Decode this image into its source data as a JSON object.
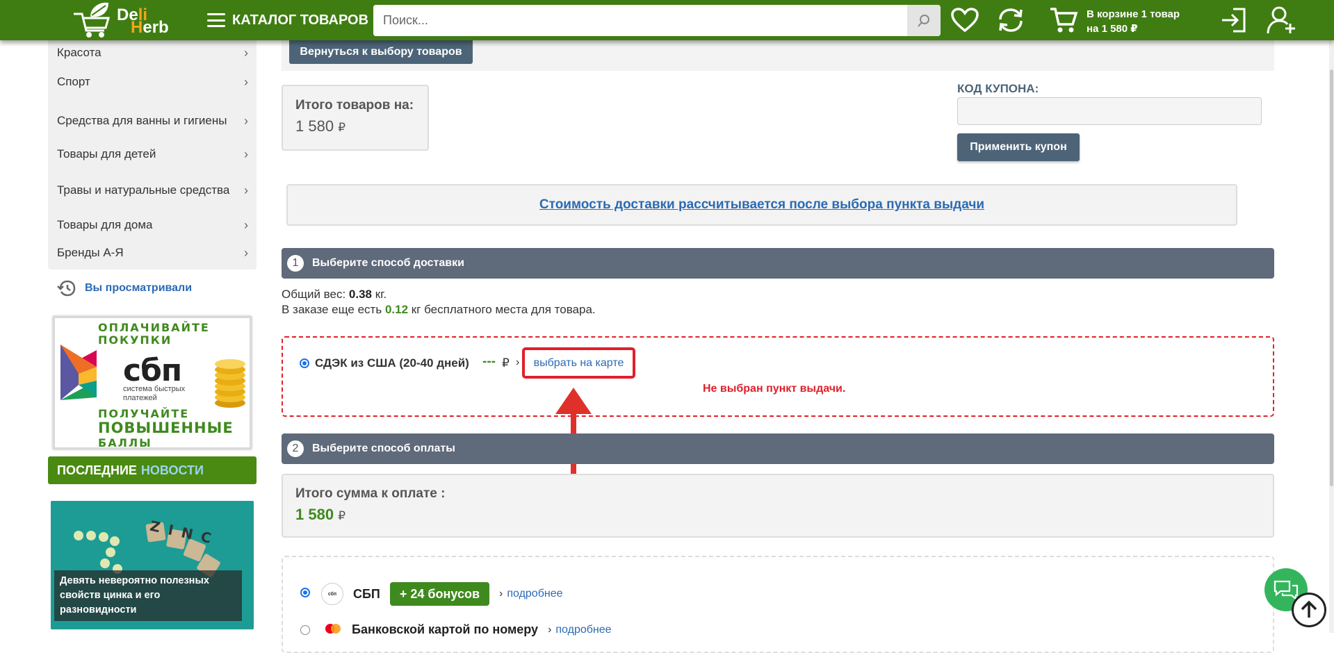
{
  "header": {
    "logo_word_1_a": "De",
    "logo_word_1_b": "li",
    "logo_word_2_a": "H",
    "logo_word_2_b": "erb",
    "catalog_label": "КАТАЛОГ ТОВАРОВ",
    "search_placeholder": "Поиск...",
    "cart_line1": "В корзине 1 товар",
    "cart_line2": "на 1 580 ₽",
    "icons": [
      "search-icon",
      "heart-icon",
      "compare-icon",
      "cart-icon",
      "login-icon",
      "add-user-icon"
    ]
  },
  "sidebar": {
    "items": [
      {
        "label": "Красота"
      },
      {
        "label": "Спорт"
      },
      {
        "label": "Средства для ванны и гигиены"
      },
      {
        "label": "Товары для детей"
      },
      {
        "label": "Травы и натуральные средства"
      },
      {
        "label": "Товары для дома"
      },
      {
        "label": "Бренды А-Я"
      }
    ],
    "chevron": "›",
    "viewed_label": "Вы просматривали",
    "sbp_banner": {
      "line1": "ОПЛАЧИВАЙТЕ",
      "line2": "ПОКУПКИ",
      "logo": "сбп",
      "logo_sub": "система быстрых платежей",
      "line3": "ПОЛУЧАЙТЕ",
      "line4": "ПОВЫШЕННЫЕ",
      "line5": "БАЛЛЫ"
    },
    "news_title_1": "ПОСЛЕДНИЕ",
    "news_title_2": "НОВОСТИ",
    "news_caption": "Девять невероятно полезных свойств цинка и его разновидности",
    "news_image_letters": "ZINC"
  },
  "main": {
    "back_button": "Вернуться к выбору товаров",
    "total_label": "Итого товаров на:",
    "total_value": "1 580",
    "currency": "₽",
    "coupon_label": "КОД КУПОНА:",
    "coupon_value": "",
    "coupon_button": "Применить купон",
    "delivery_note": "Стоимость доставки рассчитывается после выбора пункта выдачи",
    "step1_num": "1",
    "step1_title": "Выберите способ доставки",
    "weight_label": "Общий вес:",
    "weight_value": "0.38",
    "weight_unit": "кг.",
    "free_prefix": "В заказе еще есть",
    "free_value": "0.12",
    "free_suffix": "кг бесплатного места для товара.",
    "ship_label": "СДЭК из США (20-40 дней)",
    "ship_dash": "---",
    "ship_currency": "₽",
    "ship_chev": "›",
    "map_link": "выбрать на карте",
    "ship_error": "Не выбран пункт выдачи.",
    "step2_num": "2",
    "step2_title": "Выберите способ оплаты",
    "pay_total_label": "Итого сумма к оплате :",
    "pay_total_value": "1 580",
    "pay_methods": [
      {
        "name": "СБП",
        "icon_text": "сбп",
        "bonus": "+ 24 бонусов",
        "more": "подробнее",
        "chev": "›",
        "selected": true
      },
      {
        "name": "Банковской картой по номеру",
        "more": "подробнее",
        "chev": "›",
        "selected": false
      }
    ]
  },
  "colors": {
    "header_green": "#3f7d12",
    "slate": "#4d6478",
    "step_bar": "#5f6a7a",
    "error_red": "#e0202a",
    "link_blue": "#2b6ab3",
    "bonus_green": "#3f8a1e",
    "chat_green": "#34b55d"
  }
}
